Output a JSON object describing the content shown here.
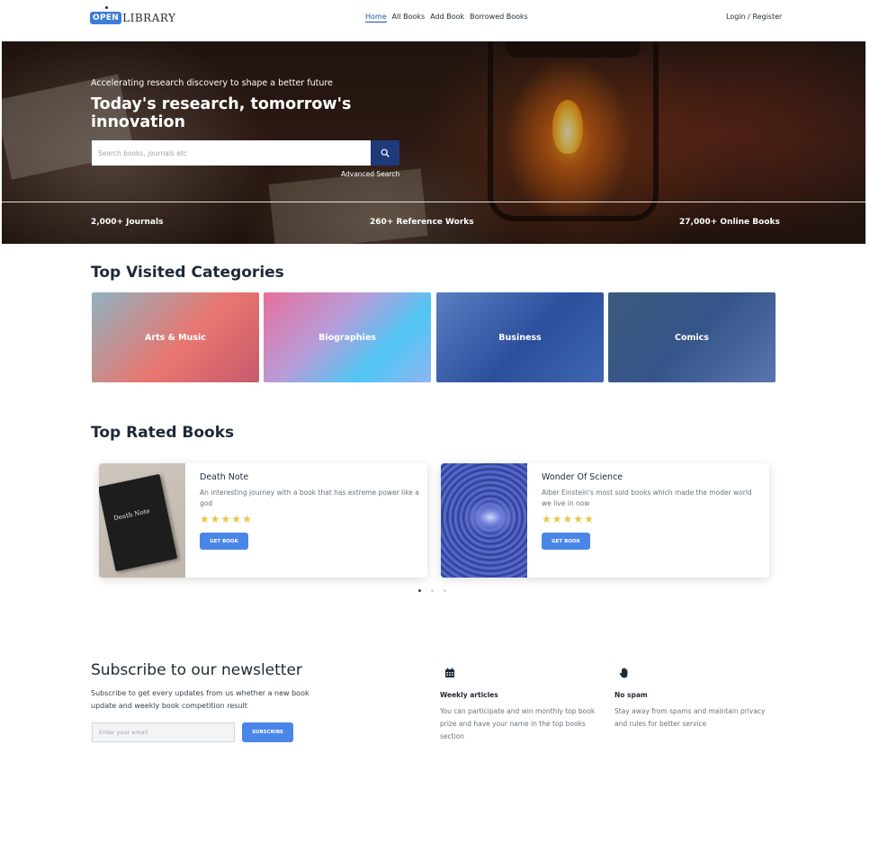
{
  "nav": {
    "logo_open": "OPEN",
    "logo_library": "LIBRARY",
    "links": [
      "Home",
      "All Books",
      "Add Book",
      "Borrowed Books"
    ],
    "login": "Login / Register"
  },
  "hero": {
    "tagline": "Accelerating research discovery to shape a better future",
    "headline": "Today's research, tomorrow's innovation",
    "search_placeholder": "Search books, journals etc",
    "advanced": "Advanced Search",
    "stats": [
      "2,000+ Journals",
      "260+ Reference Works",
      "27,000+ Online Books"
    ]
  },
  "categories": {
    "title": "Top Visited Categories",
    "items": [
      "Arts & Music",
      "Biographies",
      "Business",
      "Comics"
    ]
  },
  "books": {
    "title": "Top Rated Books",
    "items": [
      {
        "title": "Death Note",
        "description": "An interesting journey with a book that has extreme power like a god",
        "rating": 5,
        "button": "GET BOOK",
        "cover_text": "Death Note"
      },
      {
        "title": "Wonder Of Science",
        "description": "Alber Einstein's most sold books which made the moder world we live in now",
        "rating": 5,
        "button": "GET BOOK"
      }
    ],
    "carousel_active": 1,
    "carousel_count": 3
  },
  "newsletter": {
    "title": "Subscribe to our newsletter",
    "description": "Subscribe to get every updates from us whether a new book update and weekly book competition result",
    "input_placeholder": "Enter your email",
    "button": "SUBSCRIBE",
    "features": [
      {
        "icon": "calendar-icon",
        "title": "Weekly articles",
        "description": "You can participate and win monthly top book prize and have your name in the top books section"
      },
      {
        "icon": "hand-icon",
        "title": "No spam",
        "description": "Stay away from spams and maintain privacy and rules for better service"
      }
    ]
  },
  "colors": {
    "primary_dark": "#1f3a7a",
    "accent_blue": "#4a86e8",
    "star": "#e3c84a",
    "text": "#1f2937"
  }
}
